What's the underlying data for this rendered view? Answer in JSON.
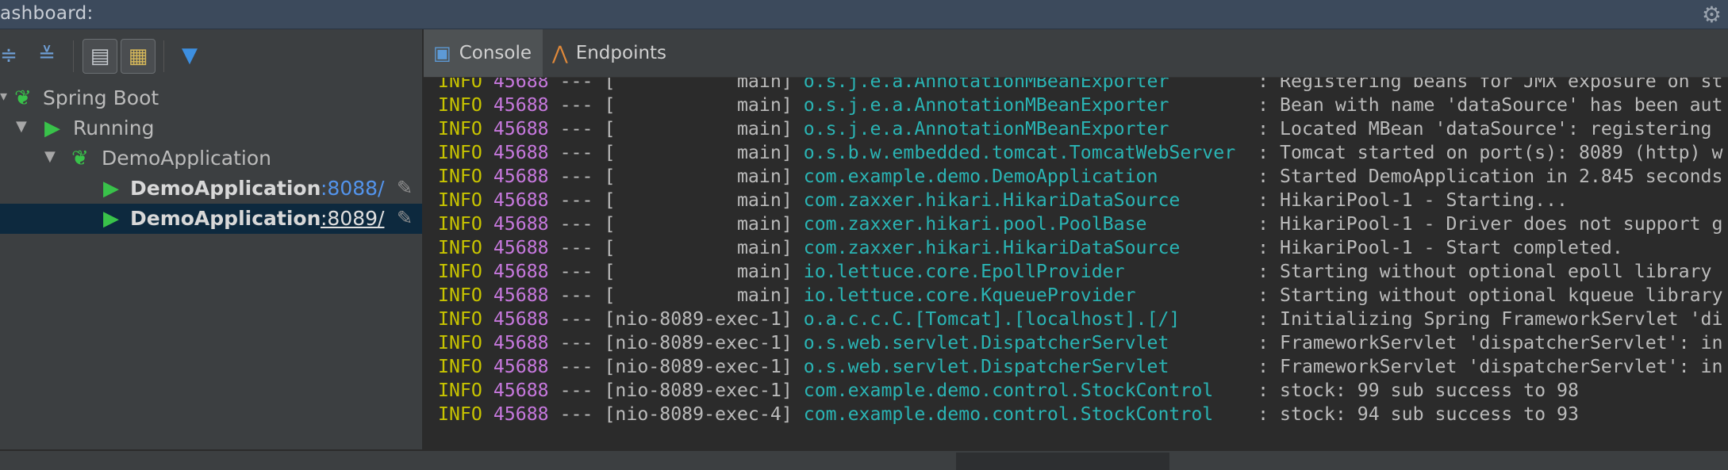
{
  "window": {
    "title": "ashboard:"
  },
  "toolbar": {
    "buttons": [
      {
        "name": "expand-all-icon",
        "glyph": "⇣"
      },
      {
        "name": "collapse-all-icon",
        "glyph": "⇅"
      },
      {
        "name": "group-by-type-icon",
        "glyph": "▤"
      },
      {
        "name": "group-by-config-icon",
        "glyph": "▦"
      },
      {
        "name": "filter-icon",
        "glyph": "▼"
      }
    ]
  },
  "tree": {
    "nodes": [
      {
        "label": "Spring Boot",
        "icon": "spring-boot-icon",
        "level": 0
      },
      {
        "label": "Running",
        "icon": "run-icon",
        "level": 1
      },
      {
        "label": "DemoApplication",
        "icon": "spring-app-icon",
        "level": 2
      },
      {
        "label": "DemoApplication",
        "port": ":8088/",
        "icon": "run-icon",
        "level": 3
      },
      {
        "label": "DemoApplication",
        "port": ":8089/",
        "icon": "run-icon",
        "level": 3,
        "selected": true
      }
    ]
  },
  "tabs": [
    {
      "label": "Console",
      "icon": "console-icon",
      "active": true
    },
    {
      "label": "Endpoints",
      "icon": "endpoints-icon",
      "active": false
    }
  ],
  "console": {
    "lines": [
      {
        "level": "INFO",
        "pid": "45688",
        "sep": "---",
        "thread": "[           main]",
        "logger": "o.s.j.e.a.AnnotationMBeanExporter       ",
        "message": ": Registering beans for JMX exposure on st"
      },
      {
        "level": "INFO",
        "pid": "45688",
        "sep": "---",
        "thread": "[           main]",
        "logger": "o.s.j.e.a.AnnotationMBeanExporter       ",
        "message": ": Bean with name 'dataSource' has been aut"
      },
      {
        "level": "INFO",
        "pid": "45688",
        "sep": "---",
        "thread": "[           main]",
        "logger": "o.s.j.e.a.AnnotationMBeanExporter       ",
        "message": ": Located MBean 'dataSource': registering"
      },
      {
        "level": "INFO",
        "pid": "45688",
        "sep": "---",
        "thread": "[           main]",
        "logger": "o.s.b.w.embedded.tomcat.TomcatWebServer ",
        "message": ": Tomcat started on port(s): 8089 (http) w"
      },
      {
        "level": "INFO",
        "pid": "45688",
        "sep": "---",
        "thread": "[           main]",
        "logger": "com.example.demo.DemoApplication        ",
        "message": ": Started DemoApplication in 2.845 seconds"
      },
      {
        "level": "INFO",
        "pid": "45688",
        "sep": "---",
        "thread": "[           main]",
        "logger": "com.zaxxer.hikari.HikariDataSource      ",
        "message": ": HikariPool-1 - Starting..."
      },
      {
        "level": "INFO",
        "pid": "45688",
        "sep": "---",
        "thread": "[           main]",
        "logger": "com.zaxxer.hikari.pool.PoolBase         ",
        "message": ": HikariPool-1 - Driver does not support g"
      },
      {
        "level": "INFO",
        "pid": "45688",
        "sep": "---",
        "thread": "[           main]",
        "logger": "com.zaxxer.hikari.HikariDataSource      ",
        "message": ": HikariPool-1 - Start completed."
      },
      {
        "level": "INFO",
        "pid": "45688",
        "sep": "---",
        "thread": "[           main]",
        "logger": "io.lettuce.core.EpollProvider           ",
        "message": ": Starting without optional epoll library"
      },
      {
        "level": "INFO",
        "pid": "45688",
        "sep": "---",
        "thread": "[           main]",
        "logger": "io.lettuce.core.KqueueProvider          ",
        "message": ": Starting without optional kqueue library"
      },
      {
        "level": "INFO",
        "pid": "45688",
        "sep": "---",
        "thread": "[nio-8089-exec-1]",
        "logger": "o.a.c.c.C.[Tomcat].[localhost].[/]      ",
        "message": ": Initializing Spring FrameworkServlet 'di"
      },
      {
        "level": "INFO",
        "pid": "45688",
        "sep": "---",
        "thread": "[nio-8089-exec-1]",
        "logger": "o.s.web.servlet.DispatcherServlet       ",
        "message": ": FrameworkServlet 'dispatcherServlet': in"
      },
      {
        "level": "INFO",
        "pid": "45688",
        "sep": "---",
        "thread": "[nio-8089-exec-1]",
        "logger": "o.s.web.servlet.DispatcherServlet       ",
        "message": ": FrameworkServlet 'dispatcherServlet': in"
      },
      {
        "level": "INFO",
        "pid": "45688",
        "sep": "---",
        "thread": "[nio-8089-exec-1]",
        "logger": "com.example.demo.control.StockControl   ",
        "message": ": stock: 99 sub success to 98"
      },
      {
        "level": "INFO",
        "pid": "45688",
        "sep": "---",
        "thread": "[nio-8089-exec-4]",
        "logger": "com.example.demo.control.StockControl   ",
        "message": ": stock: 94 sub success to 93"
      }
    ]
  },
  "colors": {
    "level": "#c8c400",
    "pid": "#c678dd",
    "logger": "#2ab4b4",
    "selection": "#0d293e",
    "run_green": "#39c24a"
  }
}
